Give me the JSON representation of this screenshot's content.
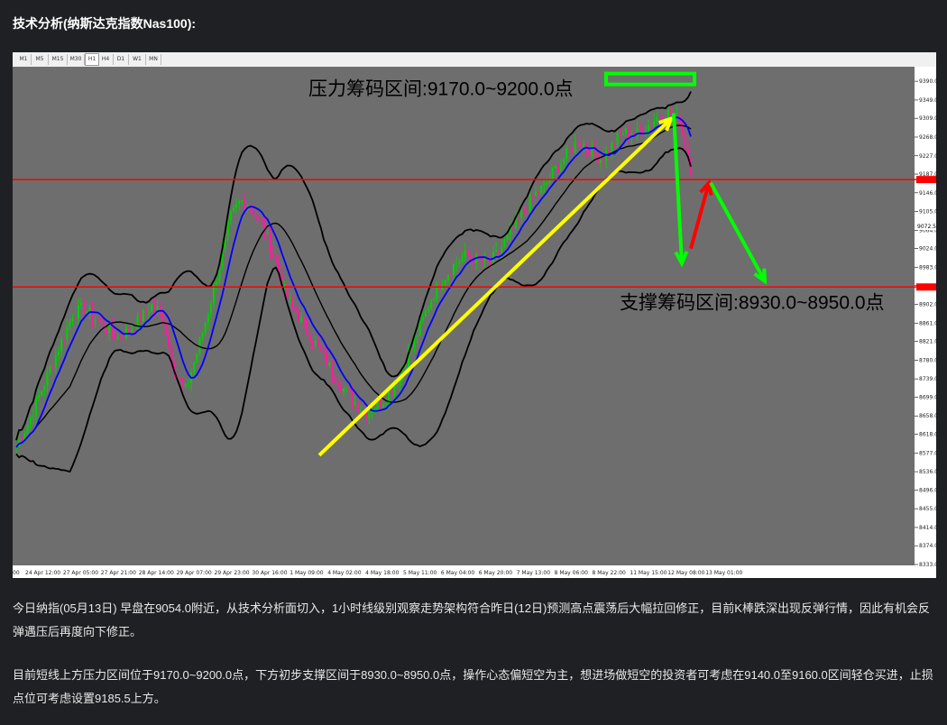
{
  "header": {
    "title": "技术分析(纳斯达克指数Nas100):"
  },
  "toolbar": {
    "timeframes": [
      "M1",
      "M5",
      "M15",
      "M30",
      "H1",
      "H4",
      "D1",
      "W1",
      "MN"
    ],
    "active": "H1"
  },
  "chart_data": {
    "type": "candlestick",
    "instrument": "Nas100",
    "timeframe": "H1",
    "ylim": [
      8333.0,
      9410.0
    ],
    "y_ticks": [
      "9390.0",
      "9349.0",
      "9309.0",
      "9268.0",
      "9227.0",
      "9187.0",
      "9146.0",
      "9105.0",
      "9064.0",
      "9024.0",
      "8983.0",
      "8943.0",
      "8902.0",
      "8861.0",
      "8821.0",
      "8780.0",
      "8739.0",
      "8699.0",
      "8658.0",
      "8618.0",
      "8577.0",
      "8536.0",
      "8496.0",
      "8455.0",
      "8414.0",
      "8374.0",
      "8333.0"
    ],
    "x_ticks": [
      "24 Apr 12:00",
      "27 Apr 05:00",
      "27 Apr 21:00",
      "28 Apr 14:00",
      "29 Apr 07:00",
      "29 Apr 23:00",
      "30 Apr 16:00",
      "1 May 09:00",
      "4 May 02:00",
      "4 May 18:00",
      "5 May 11:00",
      "6 May 04:00",
      "6 May 20:00",
      "7 May 13:00",
      "8 May 06:00",
      "8 May 22:00",
      "11 May 15:00",
      "12 May 08:00",
      "13 May 01:00"
    ],
    "first_x_label": "00",
    "current_price": "9072.5",
    "resistance_line": 9175.0,
    "support_line": 8940.0,
    "resistance_label": "压力筹码区间:9170.0~9200.0点",
    "support_label": "支撑筹码区间:8930.0~8950.0点",
    "close_path": [
      8590,
      8640,
      8700,
      8760,
      8820,
      8880,
      8895,
      8870,
      8850,
      8830,
      8845,
      8870,
      8900,
      8880,
      8760,
      8710,
      8790,
      8880,
      8980,
      9090,
      9130,
      9110,
      9070,
      9000,
      8920,
      8880,
      8840,
      8800,
      8760,
      8720,
      8690,
      8665,
      8680,
      8700,
      8740,
      8800,
      8860,
      8920,
      8960,
      8990,
      9010,
      9000,
      8990,
      9020,
      9060,
      9100,
      9140,
      9160,
      9200,
      9230,
      9260,
      9240,
      9220,
      9250,
      9280,
      9270,
      9290,
      9310,
      9320,
      9300,
      9200
    ],
    "colors": {
      "background": "#6e6e6e",
      "bull": "#00d000",
      "bear": "#ff1ba0",
      "ma": "#0000ff",
      "band": "#000000",
      "level_line": "#ff0000",
      "trend_arrow": "#ffff00",
      "down_arrow": "#00ff00",
      "up_arrow": "#ff0000",
      "box": "#00ff00"
    }
  },
  "analysis": {
    "p1": "今日纳指(05月13日) 早盘在9054.0附近，从技术分析面切入，1小时线级别观察走势架构符合昨日(12日)预测高点震荡后大幅拉回修正，目前K棒跌深出现反弹行情，因此有机会反弹遇压后再度向下修正。",
    "p2": "目前短线上方压力区间位于9170.0~9200.0点，下方初步支撑区间于8930.0~8950.0点，操作心态偏短空为主，想进场做短空的投资者可考虑在9140.0至9160.0区间轻仓买进，止损点位可考虑设置9185.5上方。"
  }
}
